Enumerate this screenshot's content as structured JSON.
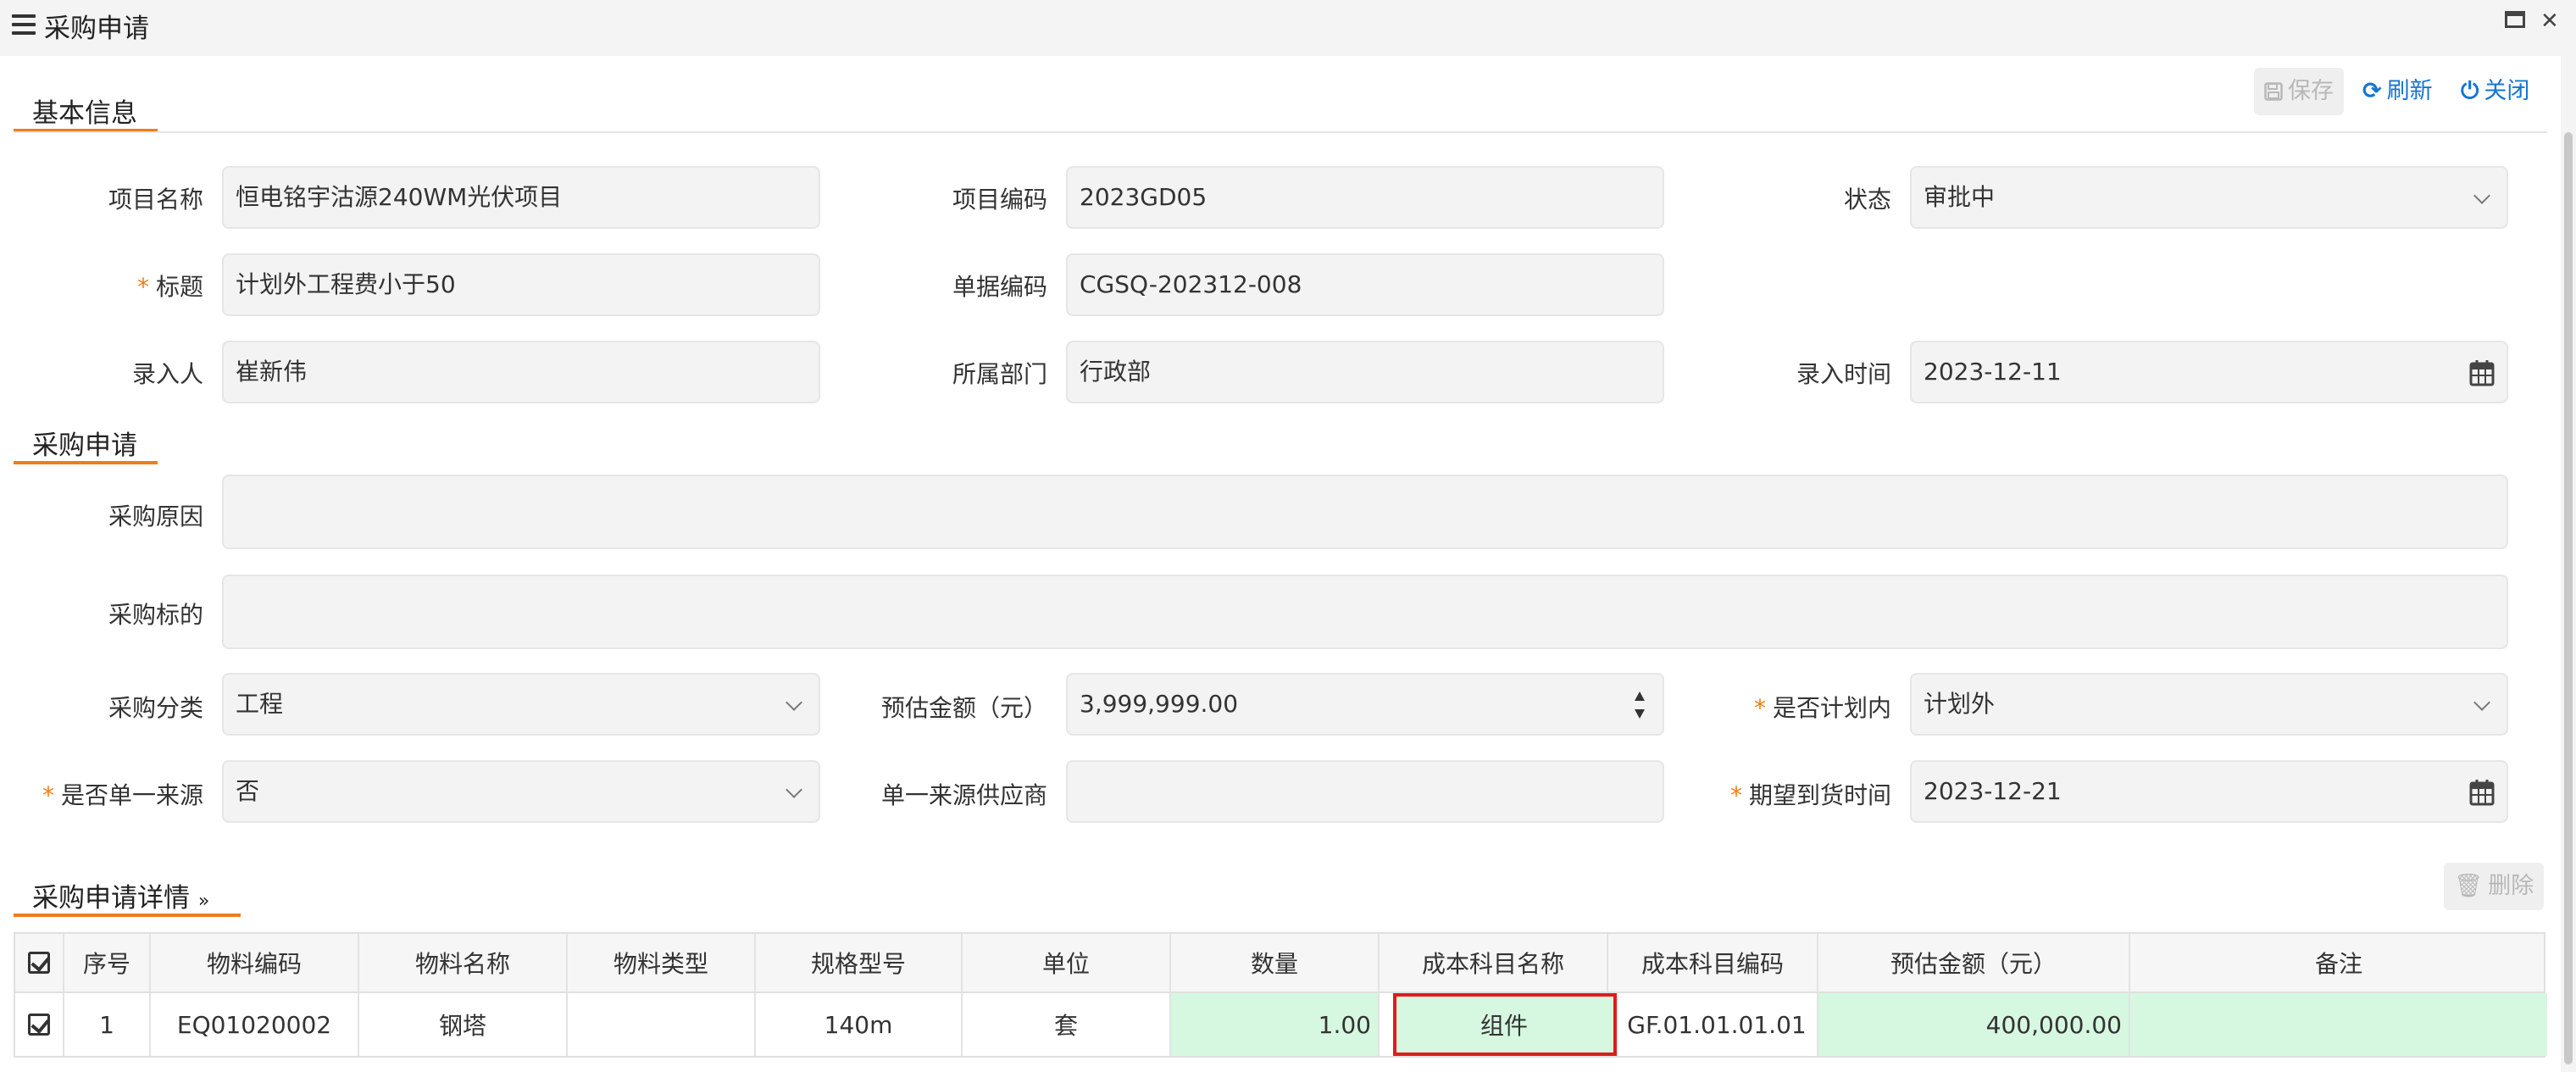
{
  "window": {
    "title": "采购申请",
    "maximize_icon": "maximize-icon",
    "close_icon": "close-icon"
  },
  "toolbar": {
    "save_label": "保存",
    "refresh_label": "刷新",
    "close_label": "关闭"
  },
  "sections": {
    "basic": "基本信息",
    "purchase": "采购申请",
    "detail": "采购申请详情"
  },
  "form": {
    "project_name": {
      "label": "项目名称",
      "value": "恒电铭宇沽源240WM光伏项目"
    },
    "project_code": {
      "label": "项目编码",
      "value": "2023GD05"
    },
    "status": {
      "label": "状态",
      "value": "审批中"
    },
    "title": {
      "label": "标题",
      "value": "计划外工程费小于50",
      "required": true
    },
    "doc_code": {
      "label": "单据编码",
      "value": "CGSQ-202312-008"
    },
    "entered_by": {
      "label": "录入人",
      "value": "崔新伟"
    },
    "department": {
      "label": "所属部门",
      "value": "行政部"
    },
    "entry_time": {
      "label": "录入时间",
      "value": "2023-12-11"
    },
    "reason": {
      "label": "采购原因",
      "value": ""
    },
    "target": {
      "label": "采购标的",
      "value": ""
    },
    "category": {
      "label": "采购分类",
      "value": "工程"
    },
    "estimated_amount": {
      "label": "预估金额（元）",
      "value": "3,999,999.00"
    },
    "in_plan": {
      "label": "是否计划内",
      "value": "计划外",
      "required": true
    },
    "single_source": {
      "label": "是否单一来源",
      "value": "否",
      "required": true
    },
    "single_supplier": {
      "label": "单一来源供应商",
      "value": ""
    },
    "expected_arrival": {
      "label": "期望到货时间",
      "value": "2023-12-21",
      "required": true
    }
  },
  "detail_toolbar": {
    "delete_label": "删除"
  },
  "grid": {
    "columns": [
      "序号",
      "物料编码",
      "物料名称",
      "物料类型",
      "规格型号",
      "单位",
      "数量",
      "成本科目名称",
      "成本科目编码",
      "预估金额（元）",
      "备注"
    ],
    "rows": [
      {
        "index": "1",
        "material_code": "EQ01020002",
        "material_name": "钢塔",
        "material_type": "",
        "spec": "140m",
        "unit": "套",
        "quantity": "1.00",
        "cost_name": "组件",
        "cost_code": "GF.01.01.01.01",
        "amount": "400,000.00",
        "remark": ""
      }
    ]
  },
  "colors": {
    "accent": "#f07c1b",
    "link": "#1574d4",
    "row_highlight": "#d6f7e0",
    "selected_cell_border": "#e01b1b"
  }
}
